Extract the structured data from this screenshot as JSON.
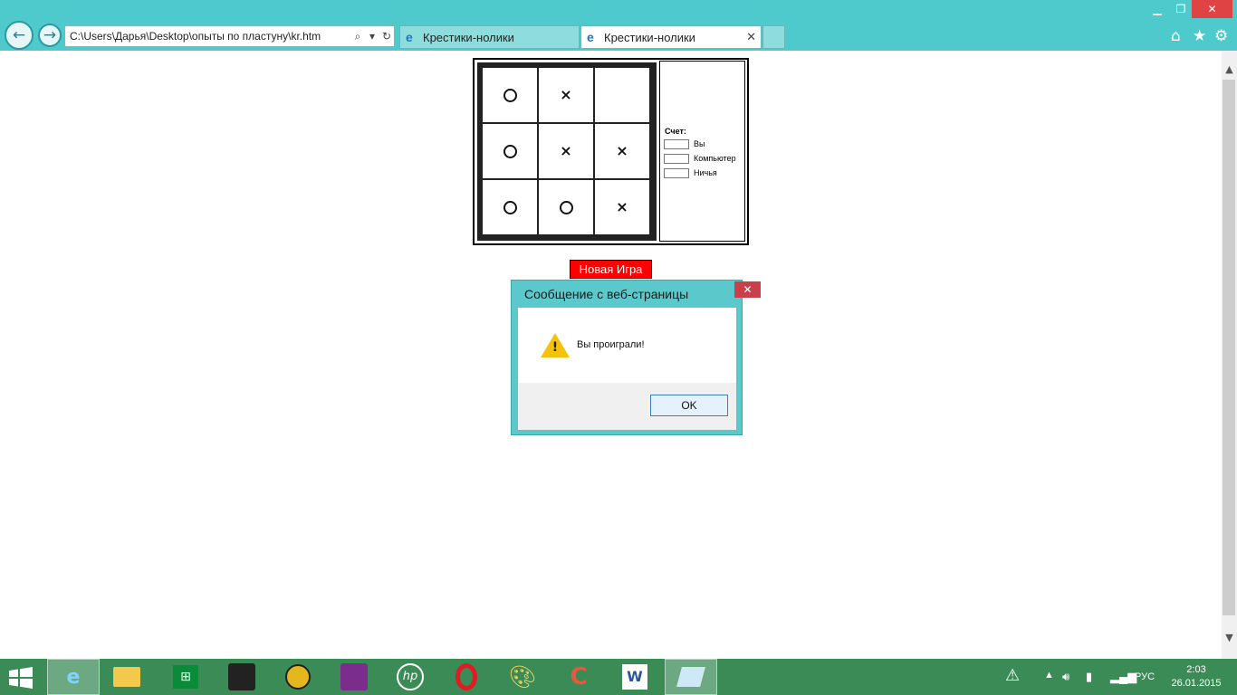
{
  "browser": {
    "address": "C:\\Users\\Дарья\\Desktop\\опыты по пластуну\\kr.htm",
    "tabs": [
      {
        "label": "Крестики-нолики"
      },
      {
        "label": "Крестики-нолики"
      }
    ]
  },
  "game": {
    "board": [
      "O",
      "X",
      "",
      "O",
      "X",
      "X",
      "O",
      "O",
      "X"
    ],
    "score": {
      "title": "Счет:",
      "rows": [
        {
          "label": "Вы"
        },
        {
          "label": "Компьютер"
        },
        {
          "label": "Ничья"
        }
      ]
    },
    "new_game_label": "Новая Игра"
  },
  "dialog": {
    "title": "Сообщение с веб-страницы",
    "message": "Вы проиграли!",
    "ok_label": "OK",
    "icon": "warning-icon"
  },
  "taskbar": {
    "language": "РУС",
    "time": "2:03",
    "date": "26.01.2015",
    "apps": [
      "internet-explorer-icon",
      "file-explorer-icon",
      "store-icon",
      "puzzle-icon",
      "media-player-icon",
      "presentation-icon",
      "hp-icon",
      "opera-icon",
      "paint-icon",
      "ccleaner-icon",
      "word-icon",
      "notepad-icon"
    ]
  },
  "colors": {
    "chrome": "#4ecacc",
    "taskbar": "#3b8b57",
    "new_game_button": "#ff0000",
    "close_button": "#e04343"
  }
}
